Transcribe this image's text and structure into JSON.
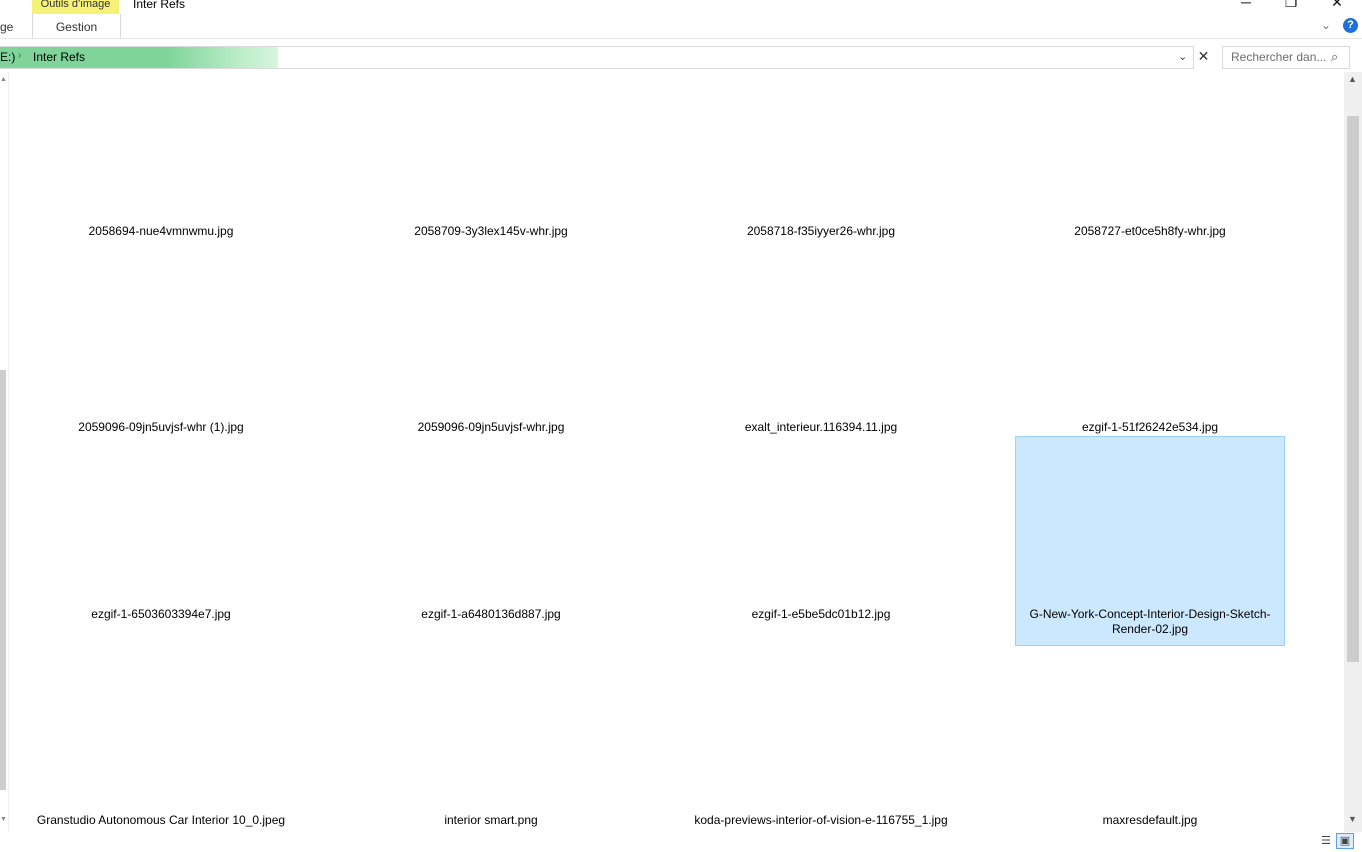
{
  "window": {
    "title": "Inter Refs",
    "minimize": "─",
    "maximize": "❐",
    "close": "✕"
  },
  "ribbon": {
    "tab_left": "ge",
    "contextual_group": "Outils d’image",
    "contextual_tab": "Gestion",
    "collapse_icon": "chevron-down-icon",
    "help": "?"
  },
  "address": {
    "drive": "E:)",
    "separator": "›",
    "folder": "Inter Refs",
    "dropdown": "⌄",
    "clear": "✕"
  },
  "search": {
    "placeholder": "Rechercher dan...",
    "icon": "⌕"
  },
  "files": [
    {
      "name": "2058694-nue4vmnwmu.jpg",
      "selected": false
    },
    {
      "name": "2058709-3y3lex145v-whr.jpg",
      "selected": false
    },
    {
      "name": "2058718-f35iyyer26-whr.jpg",
      "selected": false
    },
    {
      "name": "2058727-et0ce5h8fy-whr.jpg",
      "selected": false
    },
    {
      "name": "2059096-09jn5uvjsf-whr (1).jpg",
      "selected": false
    },
    {
      "name": "2059096-09jn5uvjsf-whr.jpg",
      "selected": false
    },
    {
      "name": "exalt_interieur.116394.11.jpg",
      "selected": false
    },
    {
      "name": "ezgif-1-51f26242e534.jpg",
      "selected": false
    },
    {
      "name": "ezgif-1-6503603394e7.jpg",
      "selected": false
    },
    {
      "name": "ezgif-1-a6480136d887.jpg",
      "selected": false
    },
    {
      "name": "ezgif-1-e5be5dc01b12.jpg",
      "selected": false
    },
    {
      "name": "G-New-York-Concept-Interior-Design-Sketch-Render-02.jpg",
      "selected": true
    },
    {
      "name": "Granstudio Autonomous Car Interior 10_0.jpeg",
      "selected": false
    },
    {
      "name": "interior smart.png",
      "selected": false
    },
    {
      "name": "koda-previews-interior-of-vision-e-116755_1.jpg",
      "selected": false
    },
    {
      "name": "maxresdefault.jpg",
      "selected": false
    }
  ],
  "colors": {
    "selection_bg": "#cce8ff",
    "selection_border": "#99d1ff",
    "address_progress": "#7fd49a",
    "contextual_tab": "#f6f178"
  }
}
